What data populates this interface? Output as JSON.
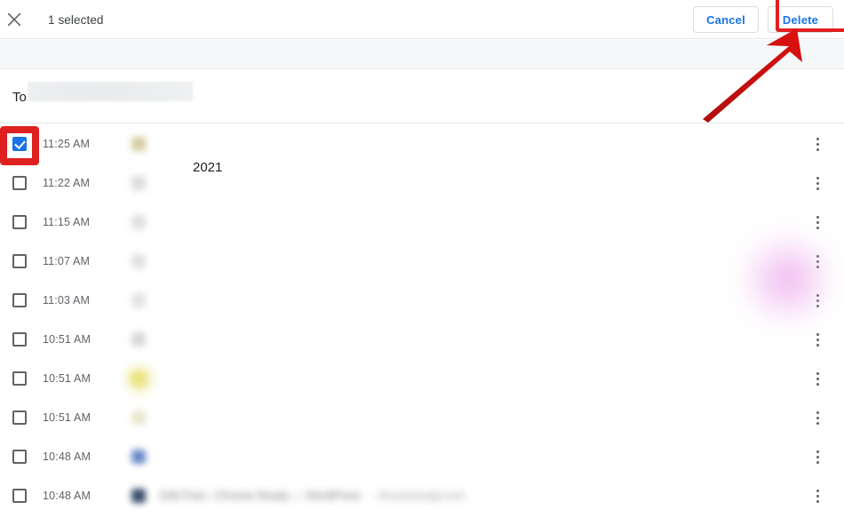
{
  "toolbar": {
    "close_icon": "close-icon",
    "selection_label": "1 selected",
    "cancel_label": "Cancel",
    "delete_label": "Delete"
  },
  "date_header": {
    "prefix": "To",
    "redacted": "",
    "year": "2021"
  },
  "annotations": {
    "highlight_color": "#e02020",
    "arrow_color": "#c41010",
    "delete_box_target": "delete-button",
    "checkbox_box_target": "row-checkbox-0",
    "arrow_target": "delete-button"
  },
  "colors": {
    "accent_blue": "#1a73e8",
    "text_primary": "#202124",
    "text_secondary": "#5f6368",
    "border": "#dadce0",
    "band": "#f5f7f9"
  },
  "list": {
    "rows": [
      {
        "time": "11:25 AM",
        "checked": true,
        "title": "",
        "url": "",
        "favicon_color": "#cfc79a",
        "menu_icon": "more-vert-icon"
      },
      {
        "time": "11:22 AM",
        "checked": false,
        "title": "",
        "url": "",
        "favicon_color": "#d8d8d8",
        "menu_icon": "more-vert-icon"
      },
      {
        "time": "11:15 AM",
        "checked": false,
        "title": "",
        "url": "",
        "favicon_color": "#dcdcdc",
        "menu_icon": "more-vert-icon"
      },
      {
        "time": "11:07 AM",
        "checked": false,
        "title": "",
        "url": "",
        "favicon_color": "#dedede",
        "menu_icon": "more-vert-icon"
      },
      {
        "time": "11:03 AM",
        "checked": false,
        "title": "",
        "url": "",
        "favicon_color": "#e0e0e0",
        "menu_icon": "more-vert-icon"
      },
      {
        "time": "10:51 AM",
        "checked": false,
        "title": "",
        "url": "",
        "favicon_color": "#d4d4d4",
        "menu_icon": "more-vert-icon"
      },
      {
        "time": "10:51 AM",
        "checked": false,
        "title": "",
        "url": "",
        "favicon_color": "#e6dd8a",
        "menu_icon": "more-vert-icon"
      },
      {
        "time": "10:51 AM",
        "checked": false,
        "title": "",
        "url": "",
        "favicon_color": "#e8e4c8",
        "menu_icon": "more-vert-icon"
      },
      {
        "time": "10:48 AM",
        "checked": false,
        "title": "",
        "url": "",
        "favicon_color": "#5b7cc4",
        "menu_icon": "more-vert-icon"
      },
      {
        "time": "10:48 AM",
        "checked": false,
        "title": "Edit Post ‹ Chrome Ready — WordPress",
        "url": "chromeready.com",
        "favicon_color": "#243a5e",
        "menu_icon": "more-vert-icon"
      }
    ]
  }
}
